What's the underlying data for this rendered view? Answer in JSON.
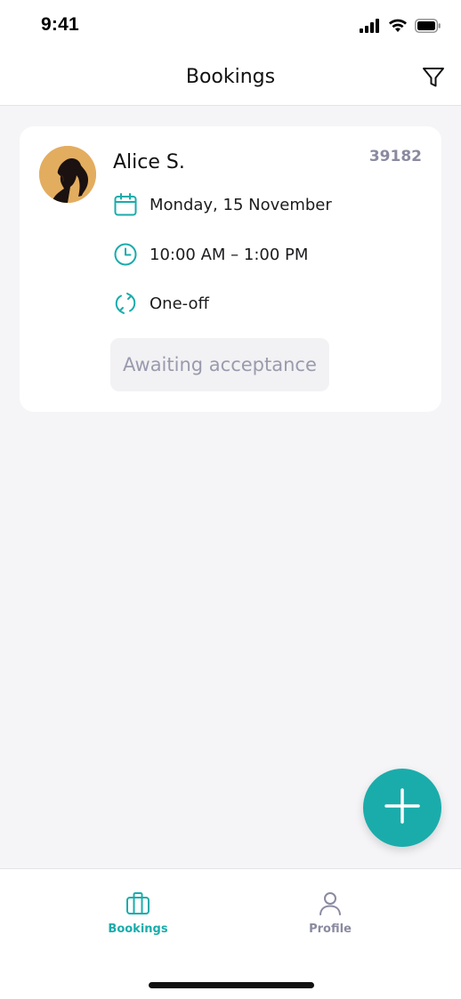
{
  "status_bar": {
    "time": "9:41",
    "icons": [
      "cellular-signal-icon",
      "wifi-icon",
      "battery-icon"
    ]
  },
  "header": {
    "title": "Bookings",
    "filter_icon": "filter-icon"
  },
  "booking": {
    "client_name": "Alice S.",
    "booking_id": "39182",
    "date": "Monday, 15 November",
    "time": "10:00 AM – 1:00 PM",
    "frequency": "One-off",
    "status": "Awaiting acceptance",
    "icons": {
      "date": "calendar-icon",
      "time": "clock-icon",
      "frequency": "repeat-icon"
    }
  },
  "fab": {
    "icon": "plus-icon"
  },
  "tab_bar": {
    "tabs": [
      {
        "label": "Bookings",
        "icon": "briefcase-icon",
        "active": true
      },
      {
        "label": "Profile",
        "icon": "person-icon",
        "active": false
      }
    ]
  },
  "colors": {
    "accent": "#1aacab",
    "background": "#f5f5f7",
    "card": "#ffffff",
    "muted_text": "#8a8aa0",
    "status_chip_bg": "#f2f2f4",
    "avatar_bg": "#e3ad5f"
  }
}
